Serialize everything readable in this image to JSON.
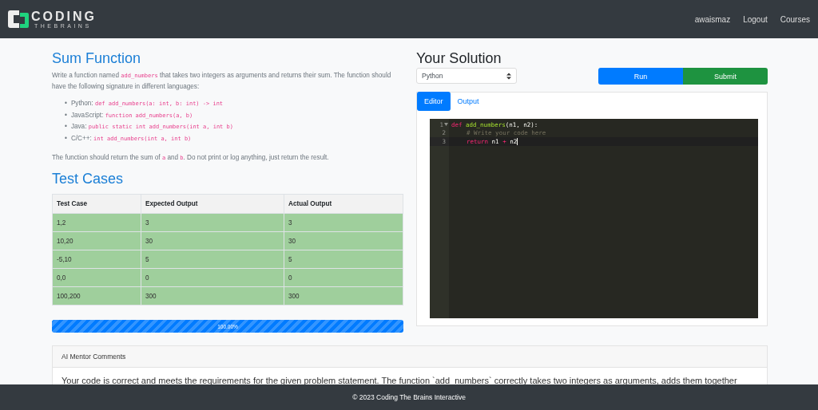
{
  "navbar": {
    "logo": {
      "word": "CODING",
      "tagline": "THEBRAINS"
    },
    "links": [
      "awaismaz",
      "Logout",
      "Courses"
    ]
  },
  "problem": {
    "title": "Sum Function",
    "intro": [
      {
        "kind": "text",
        "text": "Write a function named "
      },
      {
        "kind": "code",
        "text": "add_numbers"
      },
      {
        "kind": "text",
        "text": " that takes two integers as arguments and returns their sum. The function should have the following signature in different languages:"
      }
    ],
    "signatures": [
      {
        "marker": "•",
        "language": "Python:",
        "code": "def add_numbers(a: int, b: int) -> int"
      },
      {
        "marker": "•",
        "language": "JavaScript:",
        "code": "function add_numbers(a, b)"
      },
      {
        "marker": "•",
        "language": "Java:",
        "code": "public static int add_numbers(int a, int b)"
      },
      {
        "marker": "•",
        "language": "C/C++:",
        "code": "int add_numbers(int a, int b)"
      }
    ],
    "note": [
      {
        "kind": "text",
        "text": "The function should return the sum of "
      },
      {
        "kind": "code",
        "text": "a"
      },
      {
        "kind": "text",
        "text": " and "
      },
      {
        "kind": "code",
        "text": "b"
      },
      {
        "kind": "text",
        "text": ". Do not print or log anything, just return the result."
      }
    ]
  },
  "test_cases": {
    "title": "Test Cases",
    "columns": [
      "Test Case",
      "Expected Output",
      "Actual Output"
    ],
    "rows": [
      {
        "cells": [
          "1,2",
          "3",
          "3"
        ],
        "passed": true
      },
      {
        "cells": [
          "10,20",
          "30",
          "30"
        ],
        "passed": true
      },
      {
        "cells": [
          "-5,10",
          "5",
          "5"
        ],
        "passed": true
      },
      {
        "cells": [
          "0,0",
          "0",
          "0"
        ],
        "passed": true
      },
      {
        "cells": [
          "100,200",
          "300",
          "300"
        ],
        "passed": true
      }
    ],
    "progress": {
      "level": 1,
      "label": "100.00%"
    }
  },
  "solution": {
    "title": "Your Solution",
    "language": "Python",
    "buttons": [
      {
        "label": "Run",
        "kind": "primary"
      },
      {
        "label": "Submit",
        "kind": "success"
      }
    ],
    "tabs": [
      {
        "label": "Editor",
        "selected": true
      },
      {
        "label": "Output",
        "selected": false
      }
    ],
    "code": [
      {
        "number": "1",
        "indent": false,
        "active": false,
        "tokens": [
          {
            "kind": "keyword",
            "text": "def"
          },
          {
            "kind": "function",
            "text": "add_numbers"
          },
          {
            "kind": "plain",
            "text": "(n1, n2):"
          }
        ]
      },
      {
        "number": "2",
        "indent": true,
        "active": false,
        "tokens": [
          {
            "kind": "comment",
            "text": "# Write your code here"
          }
        ]
      },
      {
        "number": "3",
        "indent": true,
        "active": true,
        "tokens": [
          {
            "kind": "keyword",
            "text": "return"
          },
          {
            "kind": "plain",
            "text": "n1"
          },
          {
            "kind": "keyword",
            "text": "+"
          },
          {
            "kind": "plain",
            "text": "n2"
          }
        ]
      }
    ]
  },
  "mentor": {
    "title": "AI Mentor Comments",
    "comment": "Your code is correct and meets the requirements for the given problem statement. The function `add_numbers` correctly takes two integers as arguments, adds them together"
  },
  "footer": "© 2023 Coding The Brains Interactive"
}
